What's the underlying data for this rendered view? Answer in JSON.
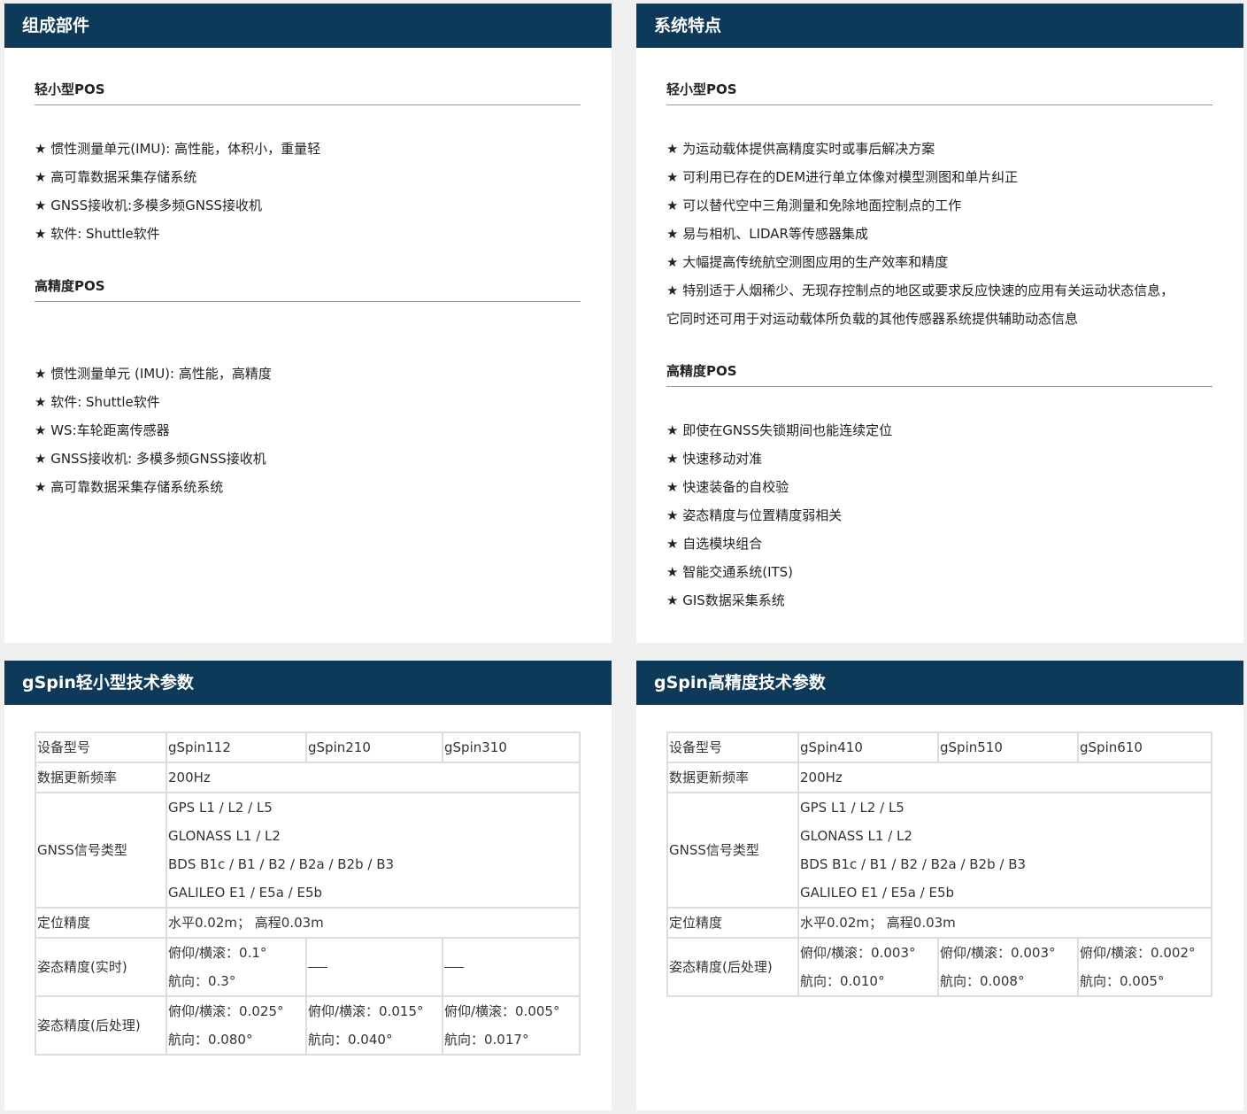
{
  "composition": {
    "title": "组成部件",
    "light": {
      "heading": "轻小型POS",
      "items": [
        "★ 惯性测量单元(IMU): 高性能，体积小，重量轻",
        "★ 高可靠数据采集存储系统",
        "★ GNSS接收机:多模多频GNSS接收机",
        "★ 软件: Shuttle软件"
      ]
    },
    "high": {
      "heading": "高精度POS",
      "items": [
        "★ 惯性测量单元 (IMU): 高性能，高精度",
        "★ 软件: Shuttle软件",
        "★ WS:车轮距离传感器",
        "★ GNSS接收机: 多模多频GNSS接收机",
        "★ 高可靠数据采集存储系统系统"
      ]
    }
  },
  "features": {
    "title": "系统特点",
    "light": {
      "heading": "轻小型POS",
      "items": [
        "★ 为运动载体提供高精度实时或事后解决方案",
        "★ 可利用已存在的DEM进行单立体像对模型测图和单片纠正",
        "★ 可以替代空中三角测量和免除地面控制点的工作",
        "★ 易与相机、LIDAR等传感器集成",
        "★ 大幅提高传统航空测图应用的生产效率和精度",
        "★ 特别适于人烟稀少、无现存控制点的地区或要求反应快速的应用有关运动状态信息，",
        "它同时还可用于对运动载体所负载的其他传感器系统提供辅助动态信息"
      ]
    },
    "high": {
      "heading": "高精度POS",
      "items": [
        "★ 即使在GNSS失锁期间也能连续定位",
        "★ 快速移动对准",
        "★ 快速装备的自校验",
        "★ 姿态精度与位置精度弱相关",
        "★ 自选模块组合",
        "★ 智能交通系统(ITS)",
        "★ GIS数据采集系统"
      ]
    }
  },
  "spec_light": {
    "title": "gSpin轻小型技术参数",
    "row_model": {
      "label": "设备型号",
      "values": [
        "gSpin112",
        "gSpin210",
        "gSpin310"
      ]
    },
    "row_rate": {
      "label": "数据更新频率",
      "value": "200Hz"
    },
    "row_gnss": {
      "label": "GNSS信号类型",
      "lines": [
        "GPS L1 / L2 / L5",
        "GLONASS L1 / L2",
        "BDS B1c / B1 / B2 / B2a / B2b / B3",
        "GALILEO E1 / E5a / E5b"
      ]
    },
    "row_pos": {
      "label": "定位精度",
      "value": "水平0.02m； 高程0.03m"
    },
    "row_rt": {
      "label": "姿态精度(实时)",
      "c1": [
        "俯仰/横滚：0.1°",
        "航向：0.3°"
      ]
    },
    "row_pp": {
      "label": "姿态精度(后处理)",
      "c1": [
        "俯仰/横滚：0.025°",
        "航向：0.080°"
      ],
      "c2": [
        "俯仰/横滚：0.015°",
        "航向：0.040°"
      ],
      "c3": [
        "俯仰/横滚：0.005°",
        "航向：0.017°"
      ]
    }
  },
  "spec_high": {
    "title": "gSpin高精度技术参数",
    "row_model": {
      "label": "设备型号",
      "values": [
        "gSpin410",
        "gSpin510",
        "gSpin610"
      ]
    },
    "row_rate": {
      "label": "数据更新频率",
      "value": "200Hz"
    },
    "row_gnss": {
      "label": "GNSS信号类型",
      "lines": [
        "GPS L1 / L2 / L5",
        "GLONASS L1 / L2",
        "BDS B1c / B1 / B2 / B2a / B2b / B3",
        "GALILEO E1 / E5a / E5b"
      ]
    },
    "row_pos": {
      "label": "定位精度",
      "value": "水平0.02m； 高程0.03m"
    },
    "row_pp": {
      "label": "姿态精度(后处理)",
      "c1": [
        "俯仰/横滚：0.003°",
        "航向：0.010°"
      ],
      "c2": [
        "俯仰/横滚：0.003°",
        "航向：0.008°"
      ],
      "c3": [
        "俯仰/横滚：0.002°",
        "航向：0.005°"
      ]
    }
  }
}
